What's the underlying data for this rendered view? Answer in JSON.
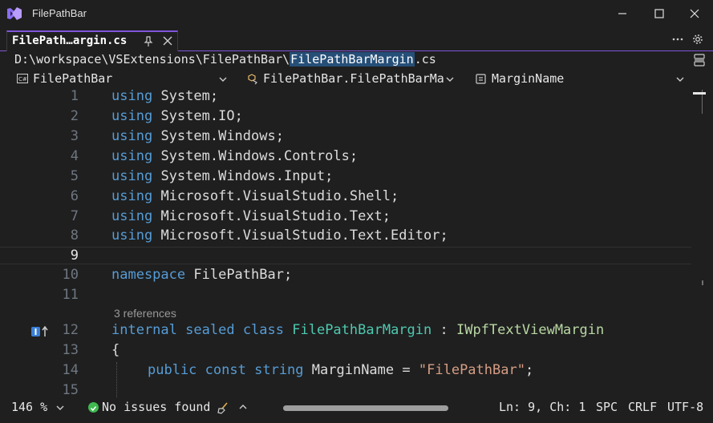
{
  "window": {
    "title": "FilePathBar",
    "accent": "#7f55d9"
  },
  "tab": {
    "label": "FilePath…argin.cs"
  },
  "path": {
    "prefix": "D:\\workspace\\VSExtensions\\FilePathBar\\",
    "selected": "FilePathBarMargin",
    "suffix": ".cs"
  },
  "nav": {
    "project": "FilePathBar",
    "type": "FilePathBar.FilePathBarMa",
    "member": "MarginName"
  },
  "code": {
    "lines": [
      {
        "n": "1"
      },
      {
        "n": "2"
      },
      {
        "n": "3"
      },
      {
        "n": "4"
      },
      {
        "n": "5"
      },
      {
        "n": "6"
      },
      {
        "n": "7"
      },
      {
        "n": "8"
      },
      {
        "n": "9"
      },
      {
        "n": "10"
      },
      {
        "n": "11"
      },
      {
        "n": "12"
      },
      {
        "n": "13"
      },
      {
        "n": "14"
      },
      {
        "n": "15"
      }
    ],
    "using_kw": "using",
    "usings": [
      [
        "System",
        ";"
      ],
      [
        "System.IO",
        ";"
      ],
      [
        "System.Windows",
        ";"
      ],
      [
        "System.Windows.Controls",
        ";"
      ],
      [
        "System.Windows.Input",
        ";"
      ],
      [
        "Microsoft.VisualStudio.Shell",
        ";"
      ],
      [
        "Microsoft.VisualStudio.Text",
        ";"
      ],
      [
        "Microsoft.VisualStudio.Text.Editor",
        ";"
      ]
    ],
    "namespace_kw": "namespace",
    "namespace_name": "FilePathBar",
    "semicolon": ";",
    "codelens": "3 references",
    "class_kw1": "internal",
    "class_kw2": "sealed",
    "class_kw3": "class",
    "class_name": "FilePathBarMargin",
    "colon": ":",
    "interface_name": "IWpfTextViewMargin",
    "open_brace": "{",
    "field_kw1": "public",
    "field_kw2": "const",
    "field_kw3": "string",
    "field_name": "MarginName",
    "equals": "=",
    "field_value": "\"FilePathBar\""
  },
  "status": {
    "zoom": "146 %",
    "issues": "No issues found",
    "position": "Ln: 9, Ch: 1",
    "whitespace": "SPC",
    "line_ending": "CRLF",
    "encoding": "UTF-8"
  }
}
